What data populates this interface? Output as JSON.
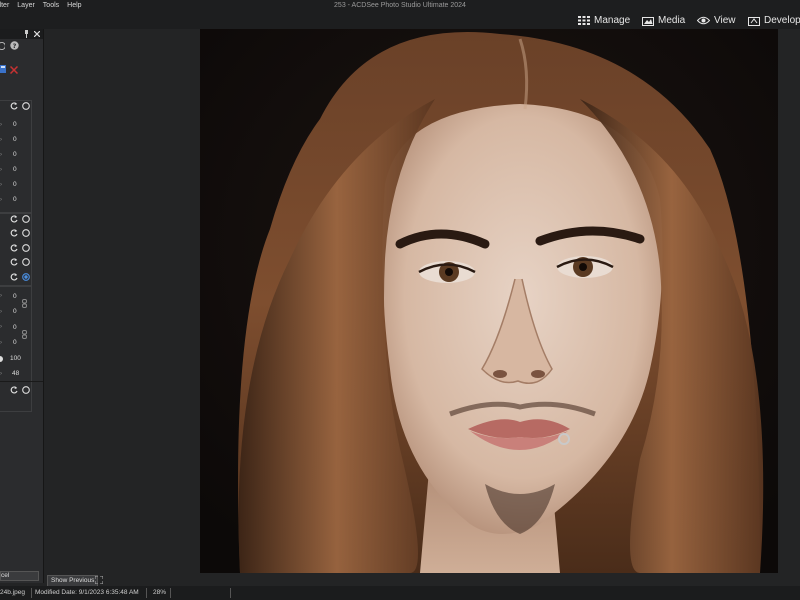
{
  "window": {
    "title": "253 - ACDSee Photo Studio Ultimate 2024"
  },
  "menu": {
    "items": [
      "ilter",
      "Layer",
      "Tools",
      "Help"
    ]
  },
  "modes": [
    {
      "label": "Manage",
      "icon": "grid-icon"
    },
    {
      "label": "Media",
      "icon": "media-icon"
    },
    {
      "label": "View",
      "icon": "eye-icon"
    },
    {
      "label": "Develop",
      "icon": "develop-icon"
    }
  ],
  "panel": {
    "values_a": [
      "0",
      "0",
      "0",
      "0",
      "0",
      "0"
    ],
    "values_b": [
      "0",
      "0",
      "0",
      "0"
    ],
    "value_c1": "100",
    "value_c2": "48",
    "cancel_label": "cel"
  },
  "toolbar": {
    "show_previous_label": "Show Previous"
  },
  "status": {
    "filename": "24b.jpeg",
    "modified": "Modified Date: 9/1/2023 6:35:48 AM",
    "zoom": "28%"
  },
  "colors": {
    "accent": "#2b6fd6",
    "close_red": "#c83232",
    "bg": "#232425",
    "panel": "#2b2c2e"
  }
}
